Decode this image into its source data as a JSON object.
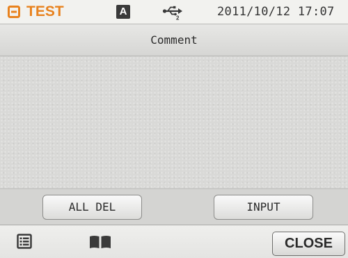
{
  "status_bar": {
    "mode_icon": "orange-mode-icon",
    "mode_label": "TEST",
    "keyboard_badge": "A",
    "usb_icon": "usb-icon",
    "usb_subscript": "2",
    "datetime": "2011/10/12 17:07"
  },
  "title": "Comment",
  "comment_area": {
    "text": ""
  },
  "actions": {
    "all_del_label": "ALL DEL",
    "input_label": "INPUT"
  },
  "bottom_bar": {
    "list_icon": "list-icon",
    "book_icon": "book-icon",
    "close_label": "CLOSE"
  },
  "colors": {
    "accent": "#e8821e",
    "background": "#d8d8d6",
    "text": "#2a2a2a"
  }
}
